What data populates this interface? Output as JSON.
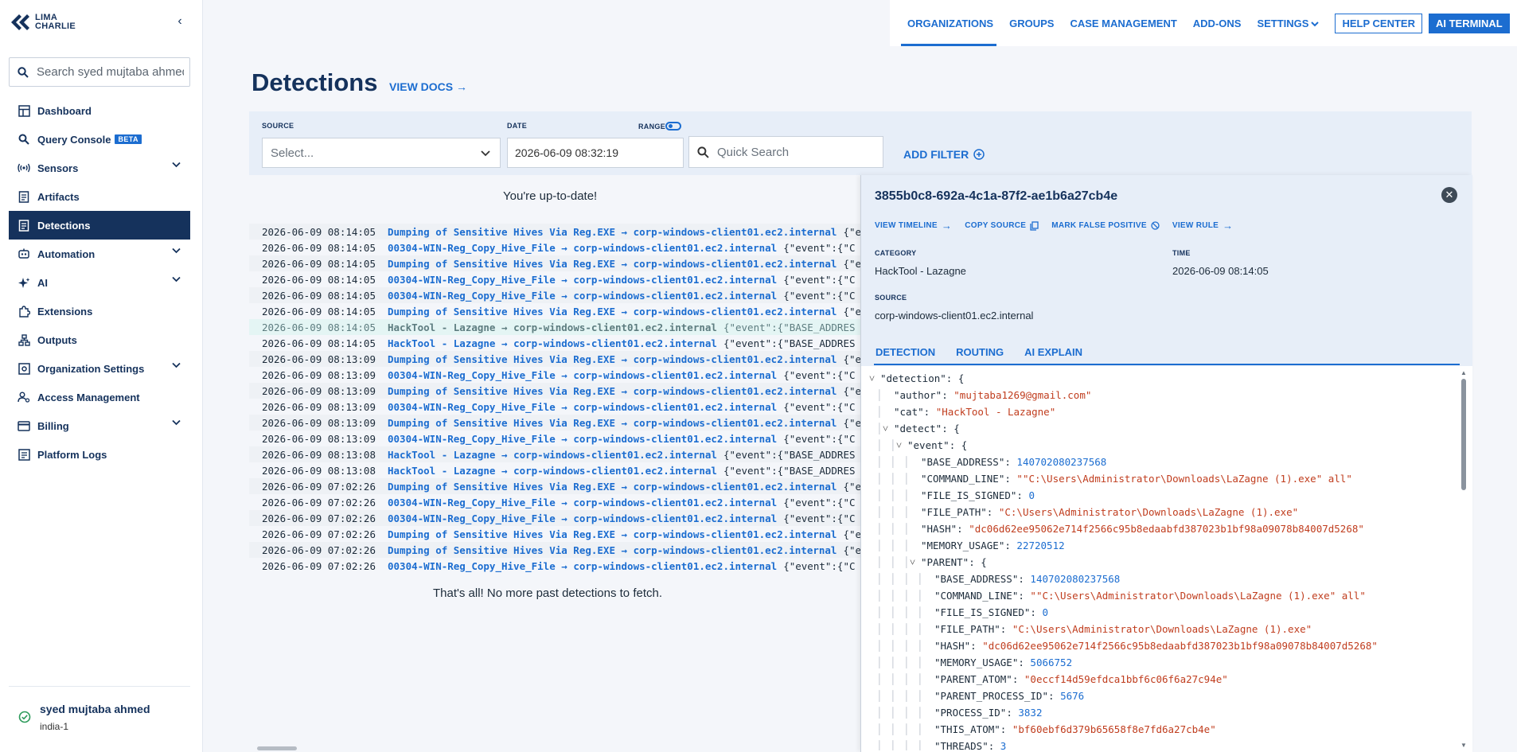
{
  "sidebar": {
    "logo_top": "LIMA",
    "logo_bottom": "CHARLIE",
    "search_placeholder": "Search syed mujtaba ahmed",
    "items": [
      {
        "label": "Dashboard",
        "icon": "dashboard-icon",
        "chevron": false
      },
      {
        "label": "Query Console",
        "icon": "search-icon",
        "chevron": false,
        "badge": "BETA"
      },
      {
        "label": "Sensors",
        "icon": "sensor-icon",
        "chevron": true
      },
      {
        "label": "Artifacts",
        "icon": "artifact-icon",
        "chevron": false
      },
      {
        "label": "Detections",
        "icon": "detection-icon",
        "chevron": false,
        "active": true
      },
      {
        "label": "Automation",
        "icon": "automation-icon",
        "chevron": true
      },
      {
        "label": "AI",
        "icon": "ai-icon",
        "chevron": true
      },
      {
        "label": "Extensions",
        "icon": "extensions-icon",
        "chevron": false
      },
      {
        "label": "Outputs",
        "icon": "outputs-icon",
        "chevron": false
      },
      {
        "label": "Organization Settings",
        "icon": "org-settings-icon",
        "chevron": true
      },
      {
        "label": "Access Management",
        "icon": "access-icon",
        "chevron": false
      },
      {
        "label": "Billing",
        "icon": "billing-icon",
        "chevron": true
      },
      {
        "label": "Platform Logs",
        "icon": "logs-icon",
        "chevron": false
      }
    ],
    "user": {
      "name": "syed mujtaba ahmed",
      "region": "india-1"
    }
  },
  "topnav": {
    "items": [
      "ORGANIZATIONS",
      "GROUPS",
      "CASE MANAGEMENT",
      "ADD-ONS",
      "SETTINGS"
    ],
    "help": "HELP CENTER",
    "terminal": "AI TERMINAL"
  },
  "page": {
    "title": "Detections",
    "view_docs": "VIEW DOCS",
    "filters": {
      "source_label": "SOURCE",
      "source_placeholder": "Select...",
      "date_label": "DATE",
      "date_value": "2026-06-09 08:32:19",
      "range_label": "RANGE",
      "quick_search_placeholder": "Quick Search",
      "add_filter": "ADD FILTER"
    },
    "uptodate": "You're up-to-date!",
    "end_text": "That's all! No more past detections to fetch."
  },
  "detections": [
    {
      "ts": "2026-06-09 08:14:05",
      "name": "Dumping of Sensitive Hives Via Reg.EXE",
      "host": "corp-windows-client01.ec2.internal",
      "ev": "{\"e"
    },
    {
      "ts": "2026-06-09 08:14:05",
      "name": "00304-WIN-Reg_Copy_Hive_File",
      "host": "corp-windows-client01.ec2.internal",
      "ev": "{\"event\":{\"C"
    },
    {
      "ts": "2026-06-09 08:14:05",
      "name": "Dumping of Sensitive Hives Via Reg.EXE",
      "host": "corp-windows-client01.ec2.internal",
      "ev": "{\"e"
    },
    {
      "ts": "2026-06-09 08:14:05",
      "name": "00304-WIN-Reg_Copy_Hive_File",
      "host": "corp-windows-client01.ec2.internal",
      "ev": "{\"event\":{\"C"
    },
    {
      "ts": "2026-06-09 08:14:05",
      "name": "00304-WIN-Reg_Copy_Hive_File",
      "host": "corp-windows-client01.ec2.internal",
      "ev": "{\"event\":{\"C"
    },
    {
      "ts": "2026-06-09 08:14:05",
      "name": "Dumping of Sensitive Hives Via Reg.EXE",
      "host": "corp-windows-client01.ec2.internal",
      "ev": "{\"e"
    },
    {
      "ts": "2026-06-09 08:14:05",
      "name": "HackTool - Lazagne",
      "host": "corp-windows-client01.ec2.internal",
      "ev": "{\"event\":{\"BASE_ADDRES",
      "selected": true
    },
    {
      "ts": "2026-06-09 08:14:05",
      "name": "HackTool - Lazagne",
      "host": "corp-windows-client01.ec2.internal",
      "ev": "{\"event\":{\"BASE_ADDRES"
    },
    {
      "ts": "2026-06-09 08:13:09",
      "name": "Dumping of Sensitive Hives Via Reg.EXE",
      "host": "corp-windows-client01.ec2.internal",
      "ev": "{\"e"
    },
    {
      "ts": "2026-06-09 08:13:09",
      "name": "00304-WIN-Reg_Copy_Hive_File",
      "host": "corp-windows-client01.ec2.internal",
      "ev": "{\"event\":{\"C"
    },
    {
      "ts": "2026-06-09 08:13:09",
      "name": "Dumping of Sensitive Hives Via Reg.EXE",
      "host": "corp-windows-client01.ec2.internal",
      "ev": "{\"e"
    },
    {
      "ts": "2026-06-09 08:13:09",
      "name": "00304-WIN-Reg_Copy_Hive_File",
      "host": "corp-windows-client01.ec2.internal",
      "ev": "{\"event\":{\"C"
    },
    {
      "ts": "2026-06-09 08:13:09",
      "name": "Dumping of Sensitive Hives Via Reg.EXE",
      "host": "corp-windows-client01.ec2.internal",
      "ev": "{\"e"
    },
    {
      "ts": "2026-06-09 08:13:09",
      "name": "00304-WIN-Reg_Copy_Hive_File",
      "host": "corp-windows-client01.ec2.internal",
      "ev": "{\"event\":{\"C"
    },
    {
      "ts": "2026-06-09 08:13:08",
      "name": "HackTool - Lazagne",
      "host": "corp-windows-client01.ec2.internal",
      "ev": "{\"event\":{\"BASE_ADDRES"
    },
    {
      "ts": "2026-06-09 08:13:08",
      "name": "HackTool - Lazagne",
      "host": "corp-windows-client01.ec2.internal",
      "ev": "{\"event\":{\"BASE_ADDRES"
    },
    {
      "ts": "2026-06-09 07:02:26",
      "name": "Dumping of Sensitive Hives Via Reg.EXE",
      "host": "corp-windows-client01.ec2.internal",
      "ev": "{\"e"
    },
    {
      "ts": "2026-06-09 07:02:26",
      "name": "00304-WIN-Reg_Copy_Hive_File",
      "host": "corp-windows-client01.ec2.internal",
      "ev": "{\"event\":{\"C"
    },
    {
      "ts": "2026-06-09 07:02:26",
      "name": "00304-WIN-Reg_Copy_Hive_File",
      "host": "corp-windows-client01.ec2.internal",
      "ev": "{\"event\":{\"C"
    },
    {
      "ts": "2026-06-09 07:02:26",
      "name": "Dumping of Sensitive Hives Via Reg.EXE",
      "host": "corp-windows-client01.ec2.internal",
      "ev": "{\"e"
    },
    {
      "ts": "2026-06-09 07:02:26",
      "name": "Dumping of Sensitive Hives Via Reg.EXE",
      "host": "corp-windows-client01.ec2.internal",
      "ev": "{\"e"
    },
    {
      "ts": "2026-06-09 07:02:26",
      "name": "00304-WIN-Reg_Copy_Hive_File",
      "host": "corp-windows-client01.ec2.internal",
      "ev": "{\"event\":{\"C"
    }
  ],
  "panel": {
    "id": "3855b0c8-692a-4c1a-87f2-ae1b6a27cb4e",
    "actions": [
      "VIEW TIMELINE",
      "COPY SOURCE",
      "MARK FALSE POSITIVE",
      "VIEW RULE"
    ],
    "category_label": "CATEGORY",
    "category": "HackTool - Lazagne",
    "time_label": "TIME",
    "time": "2026-06-09 08:14:05",
    "source_label": "SOURCE",
    "source": "corp-windows-client01.ec2.internal",
    "tabs": [
      "DETECTION",
      "ROUTING",
      "AI EXPLAIN"
    ],
    "json_lines": [
      {
        "d": 0,
        "t": "open",
        "k": "\"detection\"",
        "v": "{"
      },
      {
        "d": 1,
        "t": "s",
        "k": "\"author\"",
        "v": "\"mujtaba1269@gmail.com\""
      },
      {
        "d": 1,
        "t": "s",
        "k": "\"cat\"",
        "v": "\"HackTool - Lazagne\""
      },
      {
        "d": 1,
        "t": "open",
        "k": "\"detect\"",
        "v": "{"
      },
      {
        "d": 2,
        "t": "open",
        "k": "\"event\"",
        "v": "{"
      },
      {
        "d": 3,
        "t": "n",
        "k": "\"BASE_ADDRESS\"",
        "v": "140702080237568"
      },
      {
        "d": 3,
        "t": "s",
        "k": "\"COMMAND_LINE\"",
        "v": "\"\"C:\\Users\\Administrator\\Downloads\\LaZagne (1).exe\" all\""
      },
      {
        "d": 3,
        "t": "n",
        "k": "\"FILE_IS_SIGNED\"",
        "v": "0"
      },
      {
        "d": 3,
        "t": "s",
        "k": "\"FILE_PATH\"",
        "v": "\"C:\\Users\\Administrator\\Downloads\\LaZagne (1).exe\""
      },
      {
        "d": 3,
        "t": "s",
        "k": "\"HASH\"",
        "v": "\"dc06d62ee95062e714f2566c95b8edaabfd387023b1bf98a09078b84007d5268\""
      },
      {
        "d": 3,
        "t": "n",
        "k": "\"MEMORY_USAGE\"",
        "v": "22720512"
      },
      {
        "d": 3,
        "t": "open",
        "k": "\"PARENT\"",
        "v": "{"
      },
      {
        "d": 4,
        "t": "n",
        "k": "\"BASE_ADDRESS\"",
        "v": "140702080237568"
      },
      {
        "d": 4,
        "t": "s",
        "k": "\"COMMAND_LINE\"",
        "v": "\"\"C:\\Users\\Administrator\\Downloads\\LaZagne (1).exe\" all\""
      },
      {
        "d": 4,
        "t": "n",
        "k": "\"FILE_IS_SIGNED\"",
        "v": "0"
      },
      {
        "d": 4,
        "t": "s",
        "k": "\"FILE_PATH\"",
        "v": "\"C:\\Users\\Administrator\\Downloads\\LaZagne (1).exe\""
      },
      {
        "d": 4,
        "t": "s",
        "k": "\"HASH\"",
        "v": "\"dc06d62ee95062e714f2566c95b8edaabfd387023b1bf98a09078b84007d5268\""
      },
      {
        "d": 4,
        "t": "n",
        "k": "\"MEMORY_USAGE\"",
        "v": "5066752"
      },
      {
        "d": 4,
        "t": "s",
        "k": "\"PARENT_ATOM\"",
        "v": "\"0eccf14d59efdca1bbf6c06f6a27c94e\""
      },
      {
        "d": 4,
        "t": "n",
        "k": "\"PARENT_PROCESS_ID\"",
        "v": "5676"
      },
      {
        "d": 4,
        "t": "n",
        "k": "\"PROCESS_ID\"",
        "v": "3832"
      },
      {
        "d": 4,
        "t": "s",
        "k": "\"THIS_ATOM\"",
        "v": "\"bf60ebf6d379b65658f8e7fd6a27cb4e\""
      },
      {
        "d": 4,
        "t": "n",
        "k": "\"THREADS\"",
        "v": "3"
      }
    ]
  },
  "colors": {
    "brand": "#15325c",
    "accent": "#1c6dd0",
    "string": "#c03d1e"
  }
}
